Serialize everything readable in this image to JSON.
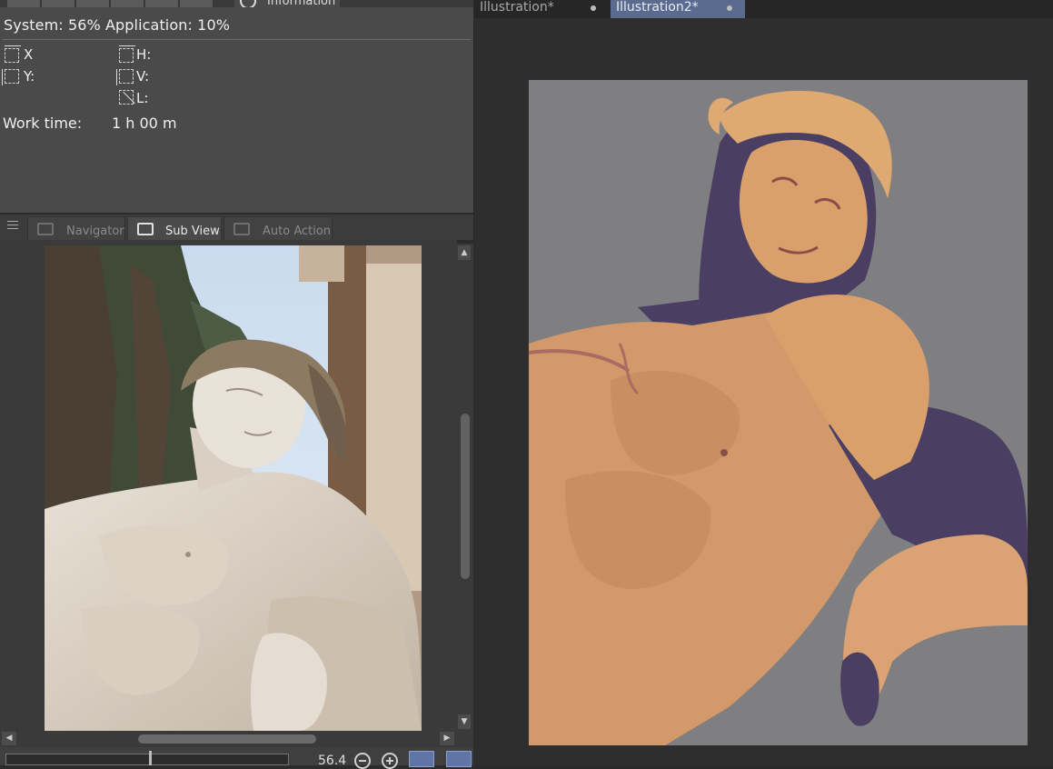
{
  "info_panel": {
    "tab_label": "Information",
    "system_text": "System: 56% Application: 10%",
    "dims": {
      "x": "X",
      "y": "Y:",
      "h": "H:",
      "v": "V:",
      "l": "L:"
    },
    "work_time_label": "Work time:",
    "work_time_value": "1 h 00 m"
  },
  "subview_panel": {
    "tabs": [
      {
        "label": "Navigator",
        "icon": "navigator-icon"
      },
      {
        "label": "Sub View",
        "icon": "sub-view-icon"
      },
      {
        "label": "Auto Action",
        "icon": "auto-action-icon"
      }
    ],
    "active_tab": "Sub View",
    "zoom_value": "56.4"
  },
  "document_tabs": [
    {
      "label": "Illustration*"
    },
    {
      "label": "Illustration2*"
    }
  ],
  "active_document": "Illustration2*",
  "colors": {
    "panel_bg": "#4a4a4a",
    "canvas_bg": "#7f7f81",
    "active_tab": "#5b6a8f",
    "skin_tone": "#d4996a",
    "shadow_purple": "#4a3f63"
  }
}
